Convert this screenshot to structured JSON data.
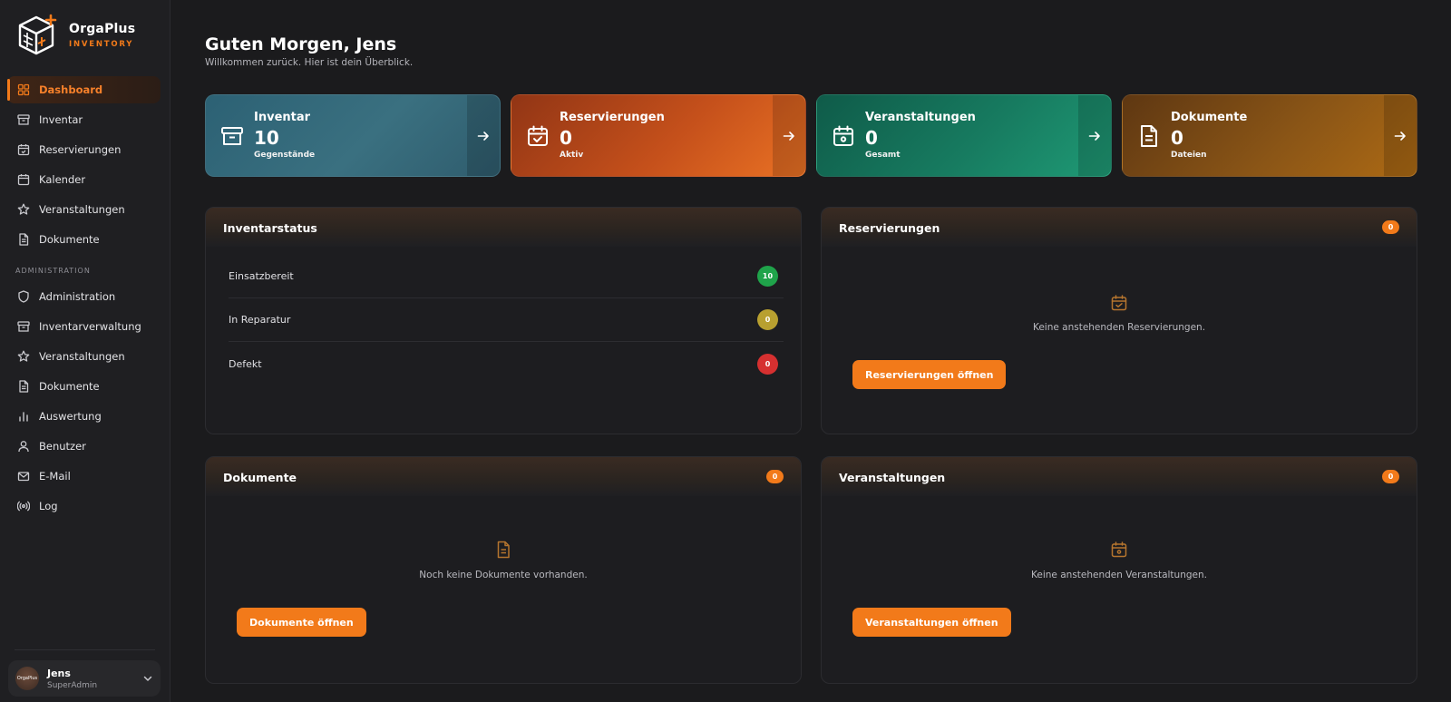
{
  "brand": {
    "name": "OrgaPlus",
    "sub": "INVENTORY"
  },
  "nav": {
    "main": [
      {
        "label": "Dashboard",
        "icon": "grid-icon",
        "active": true
      },
      {
        "label": "Inventar",
        "icon": "archive-icon"
      },
      {
        "label": "Reservierungen",
        "icon": "calendar-check-icon"
      },
      {
        "label": "Kalender",
        "icon": "calendar-icon"
      },
      {
        "label": "Veranstaltungen",
        "icon": "star-icon"
      },
      {
        "label": "Dokumente",
        "icon": "document-icon"
      }
    ],
    "admin_section": "ADMINISTRATION",
    "admin": [
      {
        "label": "Administration",
        "icon": "shield-icon"
      },
      {
        "label": "Inventarverwaltung",
        "icon": "archive-icon"
      },
      {
        "label": "Veranstaltungen",
        "icon": "star-icon"
      },
      {
        "label": "Dokumente",
        "icon": "document-icon"
      },
      {
        "label": "Auswertung",
        "icon": "bar-chart-icon"
      },
      {
        "label": "Benutzer",
        "icon": "user-icon"
      },
      {
        "label": "E-Mail",
        "icon": "mail-icon"
      },
      {
        "label": "Log",
        "icon": "broadcast-icon"
      }
    ]
  },
  "user": {
    "name": "Jens",
    "role": "SuperAdmin",
    "avatar_text": "OrgaPlus"
  },
  "header": {
    "greeting": "Guten Morgen, Jens",
    "subtitle": "Willkommen zurück. Hier ist dein Überblick."
  },
  "stats": [
    {
      "title": "Inventar",
      "value": "10",
      "sub": "Gegenstände",
      "icon": "archive-icon",
      "color": "#3a7080"
    },
    {
      "title": "Reservierungen",
      "value": "0",
      "sub": "Aktiv",
      "icon": "calendar-check-icon",
      "color": "#ea7224"
    },
    {
      "title": "Veranstaltungen",
      "value": "0",
      "sub": "Gesamt",
      "icon": "calendar-event-icon",
      "color": "#1f9a75"
    },
    {
      "title": "Dokumente",
      "value": "0",
      "sub": "Dateien",
      "icon": "document-icon",
      "color": "#ad6a14"
    }
  ],
  "inventory_status": {
    "title": "Inventarstatus",
    "rows": [
      {
        "label": "Einsatzbereit",
        "count": "10",
        "color": "#1fa34a"
      },
      {
        "label": "In Reparatur",
        "count": "0",
        "color": "#b8a030"
      },
      {
        "label": "Defekt",
        "count": "0",
        "color": "#d63030"
      }
    ]
  },
  "reservations_panel": {
    "title": "Reservierungen",
    "badge": "0",
    "empty_text": "Keine anstehenden Reservierungen.",
    "button": "Reservierungen öffnen"
  },
  "documents_panel": {
    "title": "Dokumente",
    "badge": "0",
    "empty_text": "Noch keine Dokumente vorhanden.",
    "button": "Dokumente öffnen"
  },
  "events_panel": {
    "title": "Veranstaltungen",
    "badge": "0",
    "empty_text": "Keine anstehenden Veranstaltungen.",
    "button": "Veranstaltungen öffnen"
  },
  "colors": {
    "accent": "#f27a1a",
    "background": "#1b1b1d",
    "sidebar": "#1f1f22"
  }
}
